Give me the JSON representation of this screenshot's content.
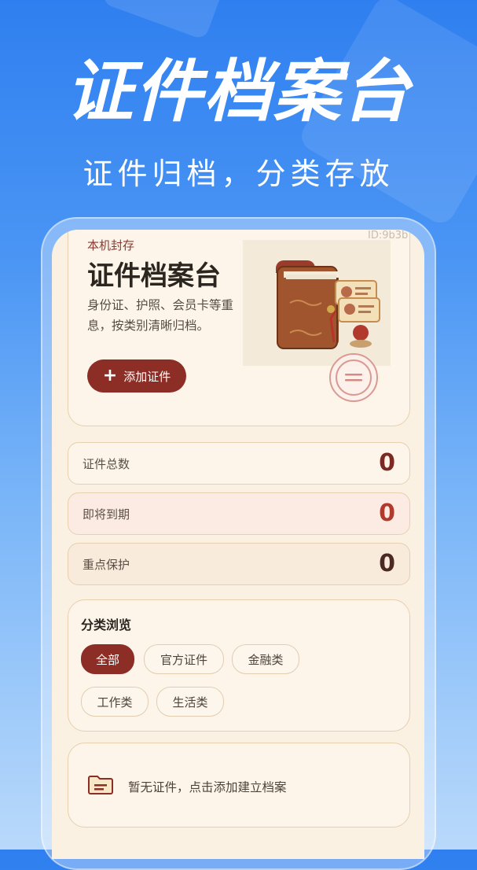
{
  "promo": {
    "title": "证件档案台",
    "subtitle": "证件归档，分类存放"
  },
  "app": {
    "id_label": "ID:9b3b",
    "hero": {
      "tag": "本机封存",
      "title": "证件档案台",
      "desc_line1": "身份证、护照、会员卡等重",
      "desc_line2": "息，按类别清晰归档。",
      "add_button": "添加证件",
      "image_icon": "document-folder-illustration",
      "menu_icon": "menu-icon"
    },
    "stats": [
      {
        "label": "证件总数",
        "value": "0",
        "color": "#7a2a22"
      },
      {
        "label": "即将到期",
        "value": "0",
        "color": "#b03a2e"
      },
      {
        "label": "重点保护",
        "value": "0",
        "color": "#4a2a22"
      }
    ],
    "categories": {
      "title": "分类浏览",
      "chips": [
        "全部",
        "官方证件",
        "金融类",
        "工作类",
        "生活类"
      ],
      "active": "全部"
    },
    "empty": {
      "icon": "folder-icon",
      "text": "暂无证件，点击添加建立档案"
    }
  },
  "colors": {
    "accent": "#8c2e26",
    "background_top": "#2f7ff0",
    "card": "#fdf5ea"
  }
}
